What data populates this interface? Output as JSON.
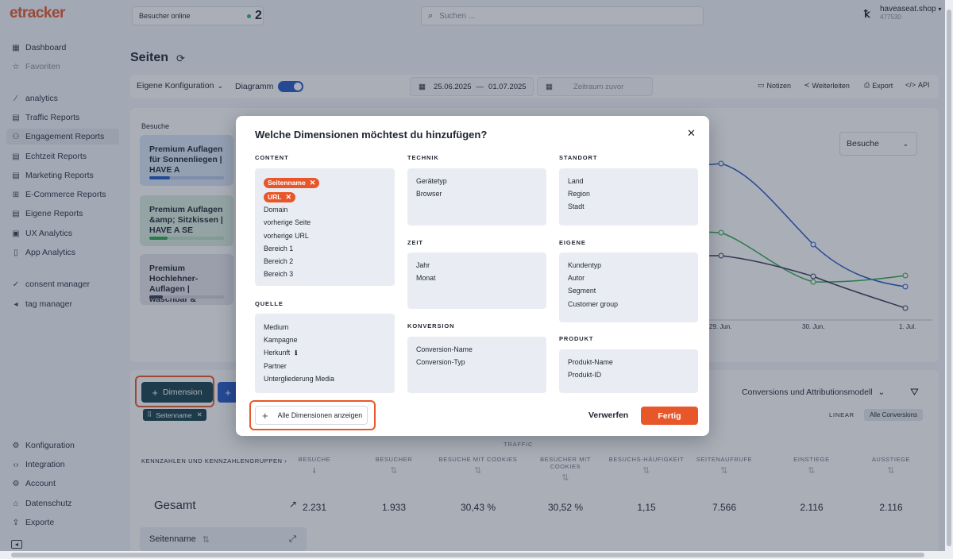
{
  "app": {
    "logo": "etracker"
  },
  "sidebar": {
    "items": [
      {
        "label": "Dashboard",
        "icon": "grid-icon"
      },
      {
        "label": "Favoriten",
        "icon": "star-icon"
      },
      {
        "label": "analytics",
        "icon": "analytics-logo-icon"
      },
      {
        "label": "Traffic Reports",
        "icon": "document-icon"
      },
      {
        "label": "Engagement Reports",
        "icon": "users-icon"
      },
      {
        "label": "Echtzeit Reports",
        "icon": "document-icon"
      },
      {
        "label": "Marketing Reports",
        "icon": "document-icon"
      },
      {
        "label": "E-Commerce Reports",
        "icon": "cart-icon"
      },
      {
        "label": "Eigene Reports",
        "icon": "document-icon"
      },
      {
        "label": "UX Analytics",
        "icon": "ux-icon"
      },
      {
        "label": "App Analytics",
        "icon": "phone-icon"
      },
      {
        "label": "consent manager",
        "icon": "consent-logo-icon"
      },
      {
        "label": "tag manager",
        "icon": "tag-logo-icon"
      }
    ],
    "bottom": [
      {
        "label": "Konfiguration",
        "icon": "gear-icon"
      },
      {
        "label": "Integration",
        "icon": "code-icon"
      },
      {
        "label": "Account",
        "icon": "settings-icon"
      },
      {
        "label": "Datenschutz",
        "icon": "bank-icon"
      },
      {
        "label": "Exporte",
        "icon": "upload-icon"
      }
    ]
  },
  "header": {
    "online_label": "Besucher online",
    "online_count": "2",
    "search_placeholder": "Suchen ...",
    "account_name": "haveaseat.shop",
    "account_id": "477530"
  },
  "page": {
    "title": "Seiten",
    "config_label": "Eigene Konfiguration",
    "diagram_label": "Diagramm",
    "date_from": "25.06.2025",
    "date_sep": "—",
    "date_to": "01.07.2025",
    "compare_label": "Zeitraum zuvor",
    "actions": [
      "Notizen",
      "Weiterleiten",
      "Export",
      "API"
    ]
  },
  "chart_card": {
    "label": "Besuche",
    "ranking": [
      "Premium Auflagen für Sonnenliegen | HAVE A",
      "Premium Auflagen &amp; Sitzkissen | HAVE A SE",
      "Premium Hochlehner-Auflagen | waschbar &"
    ],
    "metric_select": "Besuche",
    "x_labels": [
      "29. Jun.",
      "30. Jun.",
      "1. Jul."
    ]
  },
  "lower": {
    "dimension_button": "Dimension",
    "dim_tag": "Seitenname",
    "conversions_select": "Conversions und Attributionsmodell",
    "linear": "LINEAR",
    "all_conversions": "Alle Conversions",
    "traffic": "TRAFFIC",
    "group_header": "KENNZAHLEN UND KENNZAHLENGRUPPEN",
    "columns": [
      "BESUCHE",
      "BESUCHER",
      "BESUCHE MIT COOKIES",
      "BESUCHER MIT COOKIES",
      "BESUCHS-HÄUFIGKEIT",
      "SEITENAUFRUFE",
      "EINSTIEGE",
      "AUSSTIEGE"
    ],
    "total_label": "Gesamt",
    "totals": [
      "2.231",
      "1.933",
      "30,43 %",
      "30,52 %",
      "1,15",
      "7.566",
      "2.116",
      "2.116"
    ],
    "row_dim": "Seitenname"
  },
  "modal": {
    "title": "Welche Dimensionen möchtest du hinzufügen?",
    "sections": {
      "content": {
        "title": "CONTENT",
        "selected": [
          "Seitenname",
          "URL"
        ],
        "items": [
          "Domain",
          "vorherige Seite",
          "vorherige URL",
          "Bereich 1",
          "Bereich 2",
          "Bereich 3"
        ]
      },
      "quelle": {
        "title": "QUELLE",
        "items": [
          "Medium",
          "Kampagne",
          "Herkunft",
          "Partner",
          "Untergliederung Media"
        ]
      },
      "technik": {
        "title": "TECHNIK",
        "items": [
          "Gerätetyp",
          "Browser"
        ]
      },
      "zeit": {
        "title": "ZEIT",
        "items": [
          "Jahr",
          "Monat"
        ]
      },
      "konversion": {
        "title": "KONVERSION",
        "items": [
          "Conversion-Name",
          "Conversion-Typ"
        ]
      },
      "standort": {
        "title": "STANDORT",
        "items": [
          "Land",
          "Region",
          "Stadt"
        ]
      },
      "eigene": {
        "title": "EIGENE",
        "items": [
          "Kundentyp",
          "Autor",
          "Segment",
          "Customer group"
        ]
      },
      "produkt": {
        "title": "PRODUKT",
        "items": [
          "Produkt-Name",
          "Produkt-ID"
        ]
      }
    },
    "show_all_label": "Alle Dimensionen anzeigen",
    "discard_label": "Verwerfen",
    "done_label": "Fertig"
  },
  "colors": {
    "accent": "#e8572a",
    "primary": "#2458c6",
    "dark_teal": "#17404a"
  }
}
